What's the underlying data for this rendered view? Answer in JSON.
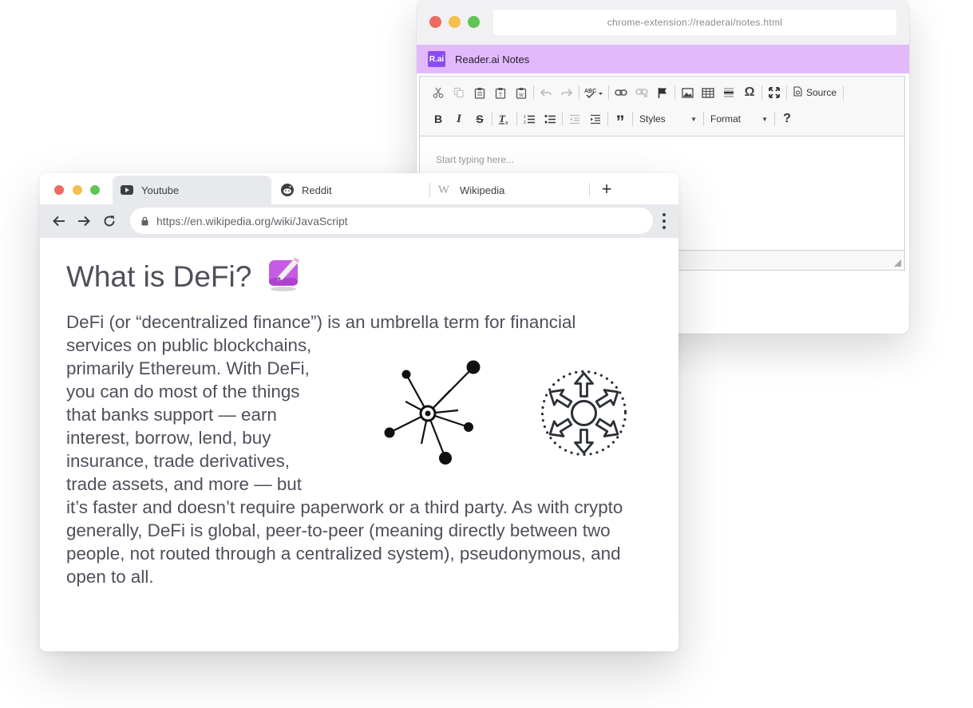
{
  "notes_window": {
    "url": "chrome-extension://readerai/notes.html",
    "logo_text": "R.ai",
    "title": "Reader.ai Notes",
    "toolbar": {
      "row1": [
        "cut-icon",
        "copy-icon",
        "paste-icon",
        "paste-text-icon",
        "paste-word-icon",
        "undo-icon",
        "redo-icon",
        "spellcheck-icon",
        "link-icon",
        "unlink-icon",
        "anchor-icon",
        "image-icon",
        "table-icon",
        "horizontal-line-icon",
        "special-char-icon",
        "maximize-icon",
        "source-icon"
      ],
      "source_label": "Source",
      "styles_label": "Styles",
      "format_label": "Format",
      "help_label": "?"
    },
    "editor_placeholder": "Start typing here..."
  },
  "browser": {
    "tabs": [
      {
        "label": "Youtube",
        "icon": "youtube-icon",
        "active": true
      },
      {
        "label": "Reddit",
        "icon": "reddit-icon",
        "active": false
      },
      {
        "label": "Wikipedia",
        "icon": "wikipedia-icon",
        "active": false
      }
    ],
    "new_tab_label": "+",
    "url": "https://en.wikipedia.org/wiki/JavaScript"
  },
  "article": {
    "heading": "What is DeFi?",
    "heading_icon": "memo-icon",
    "paragraph_lines": [
      "DeFi (or “decentralized finance”) is an umbrella term for financial",
      "services on public blockchains,",
      "primarily Ethereum. With DeFi,",
      "you can do most of the things",
      "that banks support — earn",
      "interest, borrow, lend, buy",
      "insurance, trade derivatives,",
      "trade assets, and more — but",
      "it’s faster and doesn’t require paperwork or a third party. As with crypto",
      "generally, DeFi is global, peer-to-peer (meaning directly between two",
      "people, not routed through a centralized system), pseudonymous, and",
      "open to all."
    ],
    "illustrations": [
      "network-hub-icon",
      "decentralized-arrows-icon"
    ]
  },
  "colors": {
    "notes_header_bg": "#e2b9fb",
    "logo_bg": "#8b4df2",
    "text": "#4f4f5c",
    "close": "#ec6a5e",
    "minimize": "#f4bf4f",
    "maximize": "#61c554"
  }
}
